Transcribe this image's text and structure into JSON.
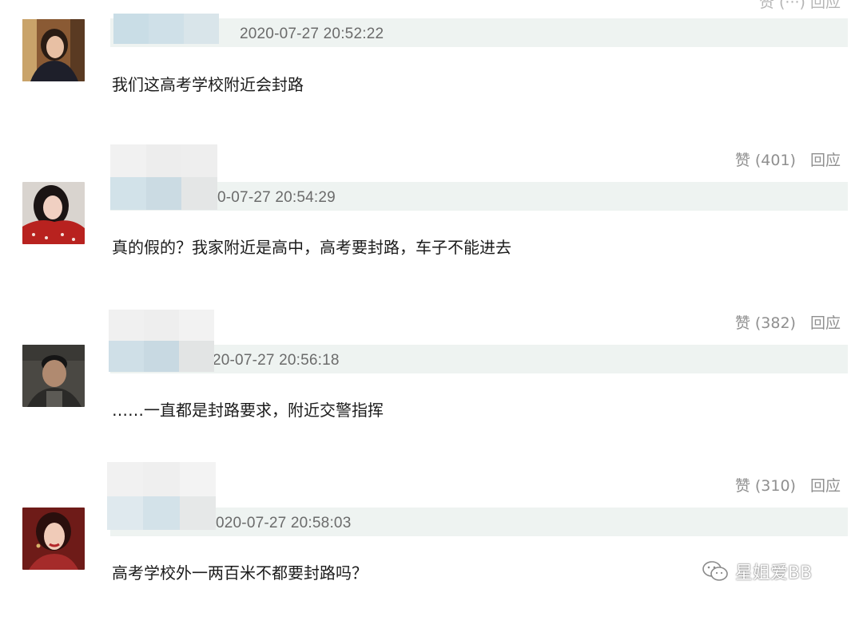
{
  "top_partial": {
    "left_text": "····",
    "actions": "赞 (···)  回应"
  },
  "comments": [
    {
      "date": "2020-07-27 20:52:22",
      "text": "我们这高考学校附近会封路",
      "like_label": "",
      "reply_label": ""
    },
    {
      "date": "0-07-27 20:54:29",
      "text": "真的假的？我家附近是高中，高考要封路，车子不能进去",
      "like_label": "赞 (401)",
      "reply_label": "回应"
    },
    {
      "date": "20-07-27 20:56:18",
      "text": "……一直都是封路要求，附近交警指挥",
      "like_label": "赞 (382)",
      "reply_label": "回应"
    },
    {
      "date": "020-07-27 20:58:03",
      "text": "高考学校外一两百米不都要封路吗？",
      "like_label": "赞 (310)",
      "reply_label": "回应"
    }
  ],
  "watermark": {
    "icon": "wechat-icon",
    "text": "星姐爱BB"
  },
  "colors": {
    "meta_bar": "#eef3f1",
    "date_text": "#6b6b6b",
    "action_text": "#8f8f8f",
    "body_text": "#1c1c1c"
  }
}
